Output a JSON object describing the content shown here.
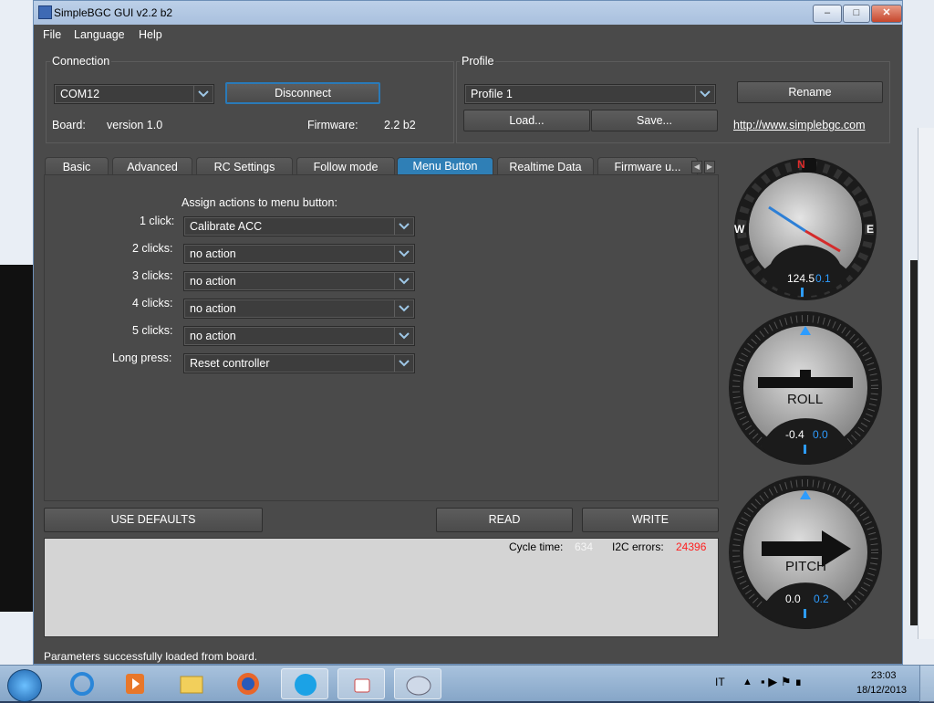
{
  "window": {
    "title": "SimpleBGC GUI v2.2 b2"
  },
  "menu": [
    "File",
    "Language",
    "Help"
  ],
  "connection": {
    "heading": "Connection",
    "port": "COM12",
    "disconnect_label": "Disconnect",
    "board_label": "Board:",
    "board_value": "version 1.0",
    "firmware_label": "Firmware:",
    "firmware_value": "2.2 b2"
  },
  "profile": {
    "heading": "Profile",
    "selected": "Profile 1",
    "rename_label": "Rename",
    "load_label": "Load...",
    "save_label": "Save...",
    "link": "http://www.simplebgc.com"
  },
  "tabs": [
    {
      "label": "Basic"
    },
    {
      "label": "Advanced"
    },
    {
      "label": "RC Settings"
    },
    {
      "label": "Follow mode"
    },
    {
      "label": "Menu Button",
      "active": true
    },
    {
      "label": "Realtime Data"
    },
    {
      "label": "Firmware u..."
    }
  ],
  "menu_button": {
    "heading": "Assign actions to menu button:",
    "rows": [
      {
        "label": "1 click:",
        "value": "Calibrate ACC"
      },
      {
        "label": "2 clicks:",
        "value": "no action"
      },
      {
        "label": "3 clicks:",
        "value": "no action"
      },
      {
        "label": "4 clicks:",
        "value": "no action"
      },
      {
        "label": "5 clicks:",
        "value": "no action"
      },
      {
        "label": "Long press:",
        "value": "Reset controller"
      }
    ]
  },
  "actions": {
    "use_defaults": "USE DEFAULTS",
    "read": "READ",
    "write": "WRITE"
  },
  "stats": {
    "cycle_label": "Cycle time:",
    "cycle_value": "634",
    "i2c_label": "I2C errors:",
    "i2c_value": "24396",
    "i2c_color": "#ff2020"
  },
  "status_bar": "Parameters successfully loaded from board.",
  "gauges": {
    "compass": {
      "n": "N",
      "e": "E",
      "w": "W",
      "value": "124.5",
      "value2": "0.1"
    },
    "roll": {
      "label": "ROLL",
      "value": "-0.4",
      "value2": "0.0"
    },
    "pitch": {
      "label": "PITCH",
      "value": "0.0",
      "value2": "0.2"
    }
  },
  "taskbar": {
    "lang": "IT",
    "time": "23:03",
    "date": "18/12/2013"
  },
  "colors": {
    "accent": "#2f7fb6",
    "value_blue": "#2d9cff",
    "window_bg": "#4a4a4a"
  }
}
